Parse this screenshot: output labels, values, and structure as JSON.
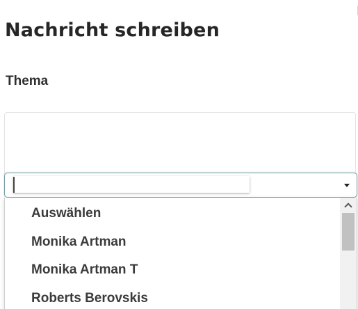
{
  "form": {
    "title": "Nachricht schreiben",
    "subject_label": "Thema",
    "subject_value": ""
  },
  "recipient_select": {
    "search_value": "",
    "options": [
      {
        "label": "Auswählen"
      },
      {
        "label": "Monika Artman"
      },
      {
        "label": "Monika Artman T"
      },
      {
        "label": "Roberts Berovskis"
      }
    ]
  },
  "icons": {
    "dropdown_arrow": "caret-down-icon",
    "scroll_up": "chevron-up-icon"
  },
  "colors": {
    "focus_border": "#7aa1a8",
    "text": "#262626",
    "scroll_thumb": "#c1c1c1"
  }
}
